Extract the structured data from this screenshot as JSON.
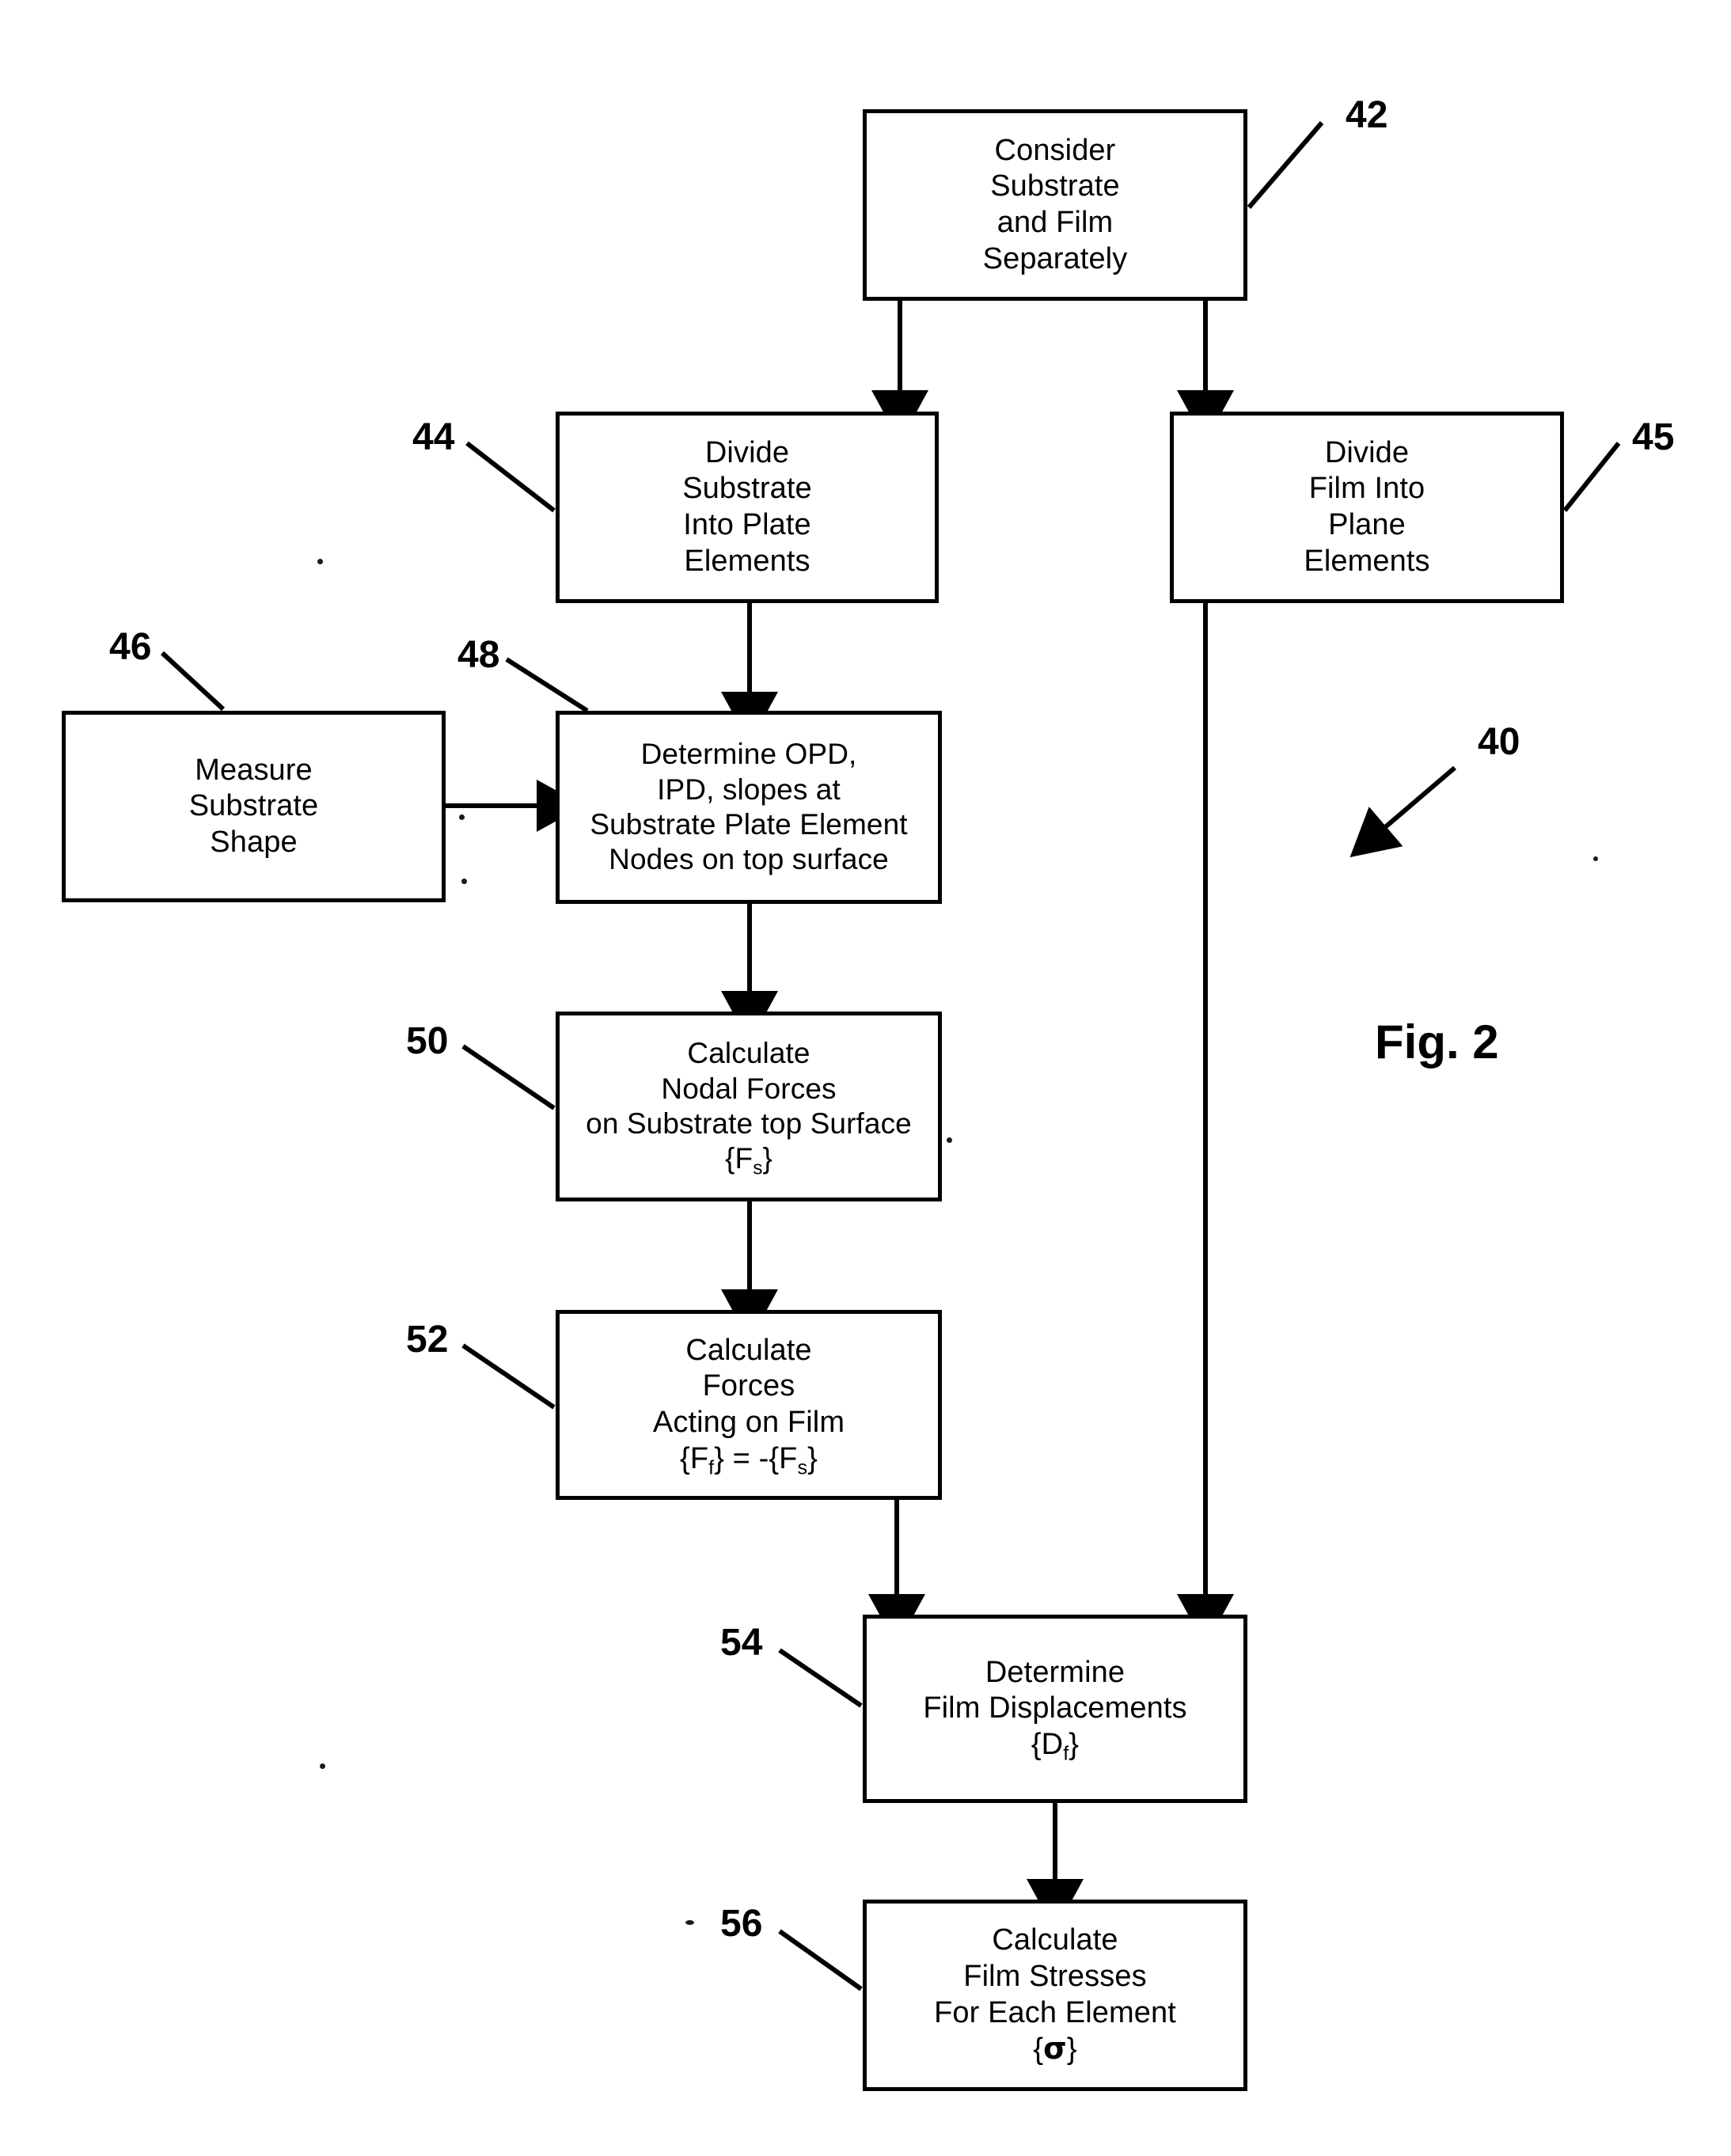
{
  "figure": {
    "label": "Fig. 2",
    "overall_ref": "40"
  },
  "nodes": [
    {
      "id": "consider",
      "ref": "42",
      "lines": [
        "Consider",
        "Substrate",
        "and Film",
        "Separately"
      ]
    },
    {
      "id": "divide-substrate",
      "ref": "44",
      "lines": [
        "Divide",
        "Substrate",
        "Into Plate",
        "Elements"
      ]
    },
    {
      "id": "divide-film",
      "ref": "45",
      "lines": [
        "Divide",
        "Film Into",
        "Plane",
        "Elements"
      ]
    },
    {
      "id": "measure-shape",
      "ref": "46",
      "lines": [
        "Measure",
        "Substrate",
        "Shape"
      ]
    },
    {
      "id": "determine-opd",
      "ref": "48",
      "lines": [
        "Determine OPD,",
        "IPD, slopes at",
        "Substrate Plate Element",
        "Nodes on top surface"
      ]
    },
    {
      "id": "nodal-forces",
      "ref": "50",
      "lines": [
        "Calculate",
        "Nodal Forces",
        "on Substrate top Surface",
        "{Fs}"
      ]
    },
    {
      "id": "film-forces",
      "ref": "52",
      "lines": [
        "Calculate",
        "Forces",
        "Acting on Film",
        "{Ff} = -{Fs}"
      ]
    },
    {
      "id": "film-displacements",
      "ref": "54",
      "lines": [
        "Determine",
        "Film Displacements",
        "{Df}"
      ]
    },
    {
      "id": "film-stresses",
      "ref": "56",
      "lines": [
        "Calculate",
        "Film Stresses",
        "For Each Element",
        "{σ}"
      ]
    }
  ],
  "box42": {
    "l1": "Consider",
    "l2": "Substrate",
    "l3": "and Film",
    "l4": "Separately",
    "ref": "42"
  },
  "box44": {
    "l1": "Divide",
    "l2": "Substrate",
    "l3": "Into Plate",
    "l4": "Elements",
    "ref": "44"
  },
  "box45": {
    "l1": "Divide",
    "l2": "Film Into",
    "l3": "Plane",
    "l4": "Elements",
    "ref": "45"
  },
  "box46": {
    "l1": "Measure",
    "l2": "Substrate",
    "l3": "Shape",
    "ref": "46"
  },
  "box48": {
    "l1": "Determine OPD,",
    "l2": "IPD, slopes at",
    "l3": "Substrate Plate Element",
    "l4": "Nodes on top surface",
    "ref": "48"
  },
  "box50": {
    "l1": "Calculate",
    "l2": "Nodal Forces",
    "l3": "on Substrate top Surface",
    "l4_pre": "{F",
    "l4_sub": "s",
    "l4_post": "}",
    "ref": "50"
  },
  "box52": {
    "l1": "Calculate",
    "l2": "Forces",
    "l3": "Acting on Film",
    "l4_a": "{F",
    "l4_suba": "f",
    "l4_b": "} = -{F",
    "l4_subb": "s",
    "l4_c": "}",
    "ref": "52"
  },
  "box54": {
    "l1": "Determine",
    "l2": "Film Displacements",
    "l3_pre": "{D",
    "l3_sub": "f",
    "l3_post": "}",
    "ref": "54"
  },
  "box56": {
    "l1": "Calculate",
    "l2": "Film Stresses",
    "l3": "For Each Element",
    "l4_pre": "{",
    "l4_sym": "σ",
    "l4_post": "}",
    "ref": "56"
  },
  "colors": {
    "ink": "#000000",
    "paper": "#ffffff"
  }
}
